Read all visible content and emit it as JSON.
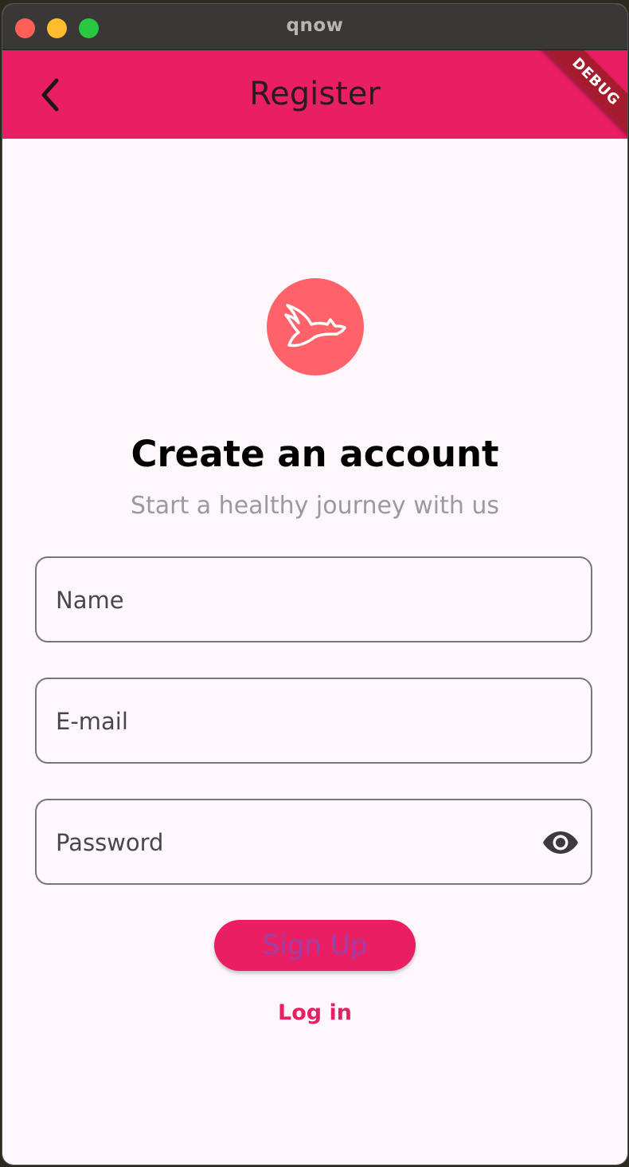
{
  "window": {
    "title": "qnow"
  },
  "appbar": {
    "title": "Register",
    "debug_banner": "DEBUG"
  },
  "content": {
    "heading": "Create an account",
    "subheading": "Start a healthy journey with us"
  },
  "form": {
    "name_placeholder": "Name",
    "email_placeholder": "E-mail",
    "password_placeholder": "Password",
    "signup_label": "Sign Up",
    "login_label": "Log in"
  },
  "icons": {
    "back": "chevron-left-icon",
    "logo": "bird-logo-icon",
    "visibility": "eye-icon"
  },
  "colors": {
    "primary": "#e91e63",
    "logo_bg": "#ff6269",
    "background": "#fdf7fc"
  }
}
